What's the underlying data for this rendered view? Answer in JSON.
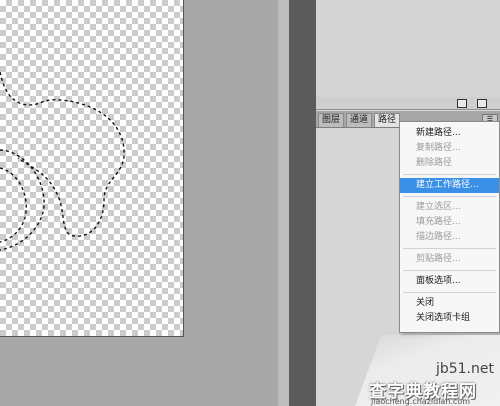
{
  "panel_tabs": [
    {
      "label": "图层",
      "active": false
    },
    {
      "label": "通道",
      "active": false
    },
    {
      "label": "路径",
      "active": true
    }
  ],
  "panel_menu_icon": "menu-arrow-icon",
  "flyout_menu": {
    "items": [
      {
        "label": "新建路径...",
        "enabled": true,
        "highlighted": false
      },
      {
        "label": "复制路径...",
        "enabled": false,
        "highlighted": false
      },
      {
        "label": "删除路径",
        "enabled": false,
        "highlighted": false
      },
      {
        "separator": true
      },
      {
        "label": "建立工作路径...",
        "enabled": true,
        "highlighted": true
      },
      {
        "separator": true
      },
      {
        "label": "建立选区...",
        "enabled": false,
        "highlighted": false
      },
      {
        "label": "填充路径...",
        "enabled": false,
        "highlighted": false
      },
      {
        "label": "描边路径...",
        "enabled": false,
        "highlighted": false
      },
      {
        "separator": true
      },
      {
        "label": "剪贴路径...",
        "enabled": false,
        "highlighted": false
      },
      {
        "separator": true
      },
      {
        "label": "面板选项...",
        "enabled": true,
        "highlighted": false
      },
      {
        "separator": true
      },
      {
        "label": "关闭",
        "enabled": true,
        "highlighted": false
      },
      {
        "label": "关闭选项卡组",
        "enabled": true,
        "highlighted": false
      }
    ]
  },
  "colors": {
    "highlight": "#3a8fe6",
    "disabled_text": "#9a9a9a"
  },
  "watermark": {
    "site": "jb51.net",
    "title": "查字典教程网",
    "url": "jiaocheng.chazidian.com"
  }
}
